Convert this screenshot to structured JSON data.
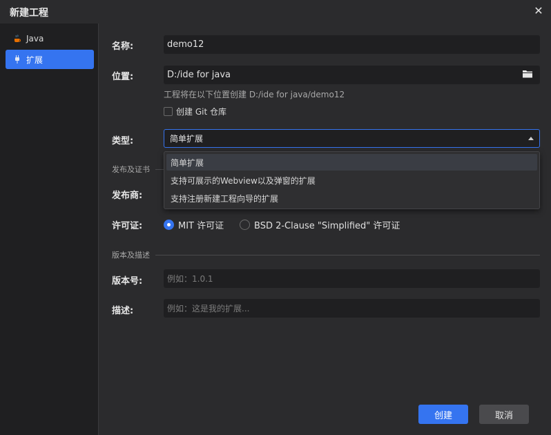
{
  "window": {
    "title": "新建工程"
  },
  "sidebar": {
    "items": [
      {
        "label": "Java",
        "icon": "java-cup-icon"
      },
      {
        "label": "扩展",
        "icon": "plug-icon",
        "active": true
      }
    ]
  },
  "form": {
    "name": {
      "label": "名称:",
      "value": "demo12"
    },
    "location": {
      "label": "位置:",
      "value": "D:/ide for java",
      "hint": "工程将在以下位置创建 D:/ide for java/demo12"
    },
    "git": {
      "label": "创建 Git 仓库",
      "checked": false
    },
    "type": {
      "label": "类型:",
      "value": "简单扩展"
    },
    "publish_section": "发布及证书",
    "publisher": {
      "label": "发布商:"
    },
    "license": {
      "label": "许可证:",
      "options": [
        {
          "label": "MIT 许可证",
          "selected": true
        },
        {
          "label": "BSD 2-Clause \"Simplified\" 许可证",
          "selected": false
        }
      ]
    },
    "version_section": "版本及描述",
    "version": {
      "label": "版本号:",
      "placeholder": "例如：1.0.1"
    },
    "description": {
      "label": "描述:",
      "placeholder": "例如：这是我的扩展..."
    }
  },
  "dropdown": {
    "options": [
      "简单扩展",
      "支持可展示的Webview以及弹窗的扩展",
      "支持注册新建工程向导的扩展"
    ],
    "highlighted_index": 0
  },
  "buttons": {
    "create": "创建",
    "cancel": "取消"
  },
  "colors": {
    "accent": "#3574f0",
    "background": "#2b2b2d",
    "sidebar": "#1f1f21"
  }
}
